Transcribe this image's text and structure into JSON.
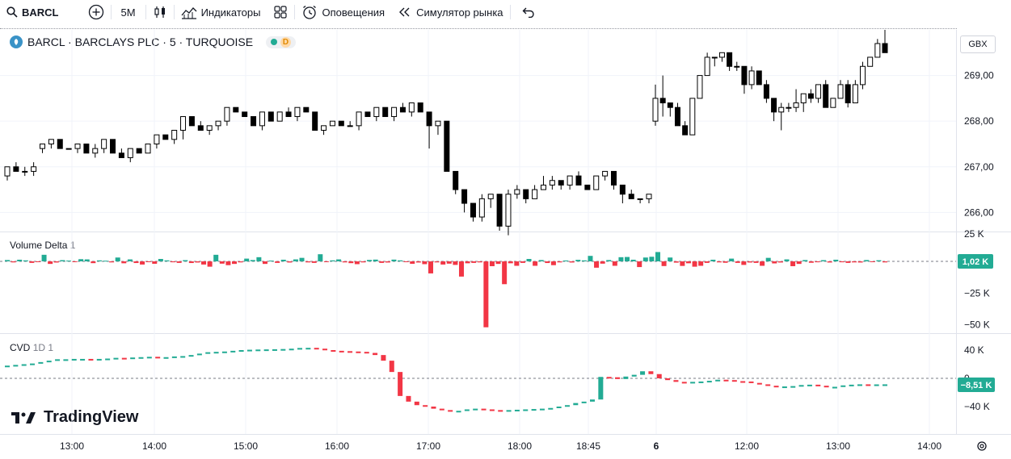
{
  "toolbar": {
    "symbol": "BARCL",
    "interval": "5M",
    "indicators": "Индикаторы",
    "alerts": "Оповещения",
    "replay": "Симулятор рынка"
  },
  "legend": {
    "title": "BARCL · BARCLAYS PLC · 5 · TURQUOISE",
    "badge": "D"
  },
  "currency": "GBX",
  "panes": {
    "volume_delta_name": "Volume Delta",
    "volume_delta_param": "1",
    "cvd_name": "CVD",
    "cvd_param": "1D 1"
  },
  "brand": {
    "name": "TradingView"
  },
  "colors": {
    "up": "#22ab94",
    "down": "#f23645",
    "candle": "#000000"
  },
  "chart_data": [
    {
      "type": "candlestick",
      "x_labels": [
        "13:00",
        "14:00",
        "15:00",
        "16:00",
        "17:00",
        "18:00",
        "18:45",
        "6",
        "12:00",
        "13:00",
        "14:00"
      ],
      "y_ticks": [
        "269,00",
        "268,00",
        "267,00",
        "266,00"
      ],
      "ylim": [
        265.6,
        270.0
      ],
      "candles": [
        [
          266.8,
          267.0,
          266.7,
          267.0
        ],
        [
          267.0,
          267.1,
          266.9,
          266.9
        ],
        [
          266.9,
          267.0,
          266.8,
          266.9
        ],
        [
          266.9,
          267.1,
          266.8,
          267.0
        ],
        [
          267.4,
          267.5,
          267.3,
          267.5
        ],
        [
          267.5,
          267.6,
          267.4,
          267.6
        ],
        [
          267.6,
          267.6,
          267.4,
          267.4
        ],
        [
          267.4,
          267.4,
          267.4,
          267.4
        ],
        [
          267.4,
          267.5,
          267.3,
          267.5
        ],
        [
          267.5,
          267.5,
          267.3,
          267.3
        ],
        [
          267.3,
          267.5,
          267.2,
          267.4
        ],
        [
          267.4,
          267.6,
          267.3,
          267.6
        ],
        [
          267.6,
          267.6,
          267.3,
          267.3
        ],
        [
          267.3,
          267.4,
          267.2,
          267.2
        ],
        [
          267.2,
          267.4,
          267.1,
          267.4
        ],
        [
          267.4,
          267.4,
          267.3,
          267.3
        ],
        [
          267.3,
          267.5,
          267.3,
          267.5
        ],
        [
          267.5,
          267.7,
          267.4,
          267.7
        ],
        [
          267.7,
          267.7,
          267.6,
          267.6
        ],
        [
          267.6,
          267.8,
          267.5,
          267.8
        ],
        [
          267.8,
          268.1,
          267.6,
          268.1
        ],
        [
          268.1,
          268.1,
          267.9,
          267.9
        ],
        [
          267.9,
          268.0,
          267.8,
          267.8
        ],
        [
          267.8,
          267.9,
          267.7,
          267.9
        ],
        [
          267.9,
          268.0,
          267.8,
          268.0
        ],
        [
          268.0,
          268.3,
          267.9,
          268.3
        ],
        [
          268.3,
          268.3,
          268.2,
          268.2
        ],
        [
          268.2,
          268.2,
          268.1,
          268.1
        ],
        [
          268.1,
          268.1,
          267.9,
          267.9
        ],
        [
          267.9,
          268.2,
          267.8,
          268.2
        ],
        [
          268.2,
          268.2,
          268.0,
          268.0
        ],
        [
          268.0,
          268.2,
          268.0,
          268.2
        ],
        [
          268.2,
          268.3,
          268.1,
          268.1
        ],
        [
          268.1,
          268.3,
          268.0,
          268.3
        ],
        [
          268.3,
          268.3,
          268.2,
          268.2
        ],
        [
          268.2,
          268.2,
          267.8,
          267.8
        ],
        [
          267.8,
          267.9,
          267.7,
          267.9
        ],
        [
          267.9,
          268.0,
          267.9,
          268.0
        ],
        [
          268.0,
          268.0,
          267.9,
          267.9
        ],
        [
          267.9,
          268.0,
          267.9,
          267.9
        ],
        [
          267.9,
          268.2,
          267.8,
          268.2
        ],
        [
          268.2,
          268.2,
          268.1,
          268.1
        ],
        [
          268.1,
          268.3,
          268.0,
          268.3
        ],
        [
          268.3,
          268.3,
          268.1,
          268.1
        ],
        [
          268.1,
          268.3,
          268.0,
          268.3
        ],
        [
          268.3,
          268.4,
          268.2,
          268.2
        ],
        [
          268.2,
          268.4,
          268.1,
          268.4
        ],
        [
          268.4,
          268.4,
          268.2,
          268.2
        ],
        [
          268.2,
          268.2,
          267.4,
          267.9
        ],
        [
          267.9,
          268.0,
          267.7,
          268.0
        ],
        [
          268.0,
          268.0,
          266.9,
          266.9
        ],
        [
          266.9,
          266.9,
          266.4,
          266.5
        ],
        [
          266.5,
          266.5,
          266.0,
          266.2
        ],
        [
          266.2,
          266.2,
          265.8,
          265.9
        ],
        [
          265.9,
          266.4,
          265.8,
          266.3
        ],
        [
          266.3,
          266.4,
          266.1,
          266.4
        ],
        [
          266.4,
          266.4,
          265.6,
          265.7
        ],
        [
          265.7,
          266.5,
          265.5,
          266.4
        ],
        [
          266.4,
          266.6,
          266.3,
          266.5
        ],
        [
          266.5,
          266.5,
          266.2,
          266.3
        ],
        [
          266.3,
          266.6,
          266.3,
          266.5
        ],
        [
          266.5,
          266.8,
          266.5,
          266.6
        ],
        [
          266.6,
          266.8,
          266.5,
          266.7
        ],
        [
          266.7,
          266.7,
          266.5,
          266.6
        ],
        [
          266.6,
          266.8,
          266.5,
          266.8
        ],
        [
          266.8,
          266.9,
          266.6,
          266.6
        ],
        [
          266.6,
          266.6,
          266.5,
          266.5
        ],
        [
          266.5,
          266.8,
          266.6,
          266.8
        ],
        [
          266.8,
          266.9,
          266.7,
          266.9
        ],
        [
          266.9,
          266.9,
          266.5,
          266.6
        ],
        [
          266.6,
          266.6,
          266.2,
          266.4
        ],
        [
          266.4,
          266.5,
          266.3,
          266.3
        ],
        [
          266.3,
          266.3,
          266.2,
          266.3
        ],
        [
          266.3,
          266.4,
          266.2,
          266.4
        ],
        [
          268.0,
          268.8,
          267.9,
          268.5
        ],
        [
          268.5,
          269.0,
          268.1,
          268.4
        ],
        [
          268.4,
          268.4,
          268.1,
          268.3
        ],
        [
          268.3,
          268.4,
          268.0,
          267.9
        ],
        [
          267.9,
          268.0,
          267.7,
          267.7
        ],
        [
          267.7,
          268.5,
          267.7,
          268.5
        ],
        [
          268.5,
          269.0,
          268.5,
          269.0
        ],
        [
          269.0,
          269.5,
          269.0,
          269.4
        ],
        [
          269.4,
          269.4,
          269.2,
          269.4
        ],
        [
          269.4,
          269.5,
          269.3,
          269.5
        ],
        [
          269.5,
          269.5,
          269.1,
          269.2
        ],
        [
          269.2,
          269.3,
          269.1,
          269.2
        ],
        [
          269.2,
          269.2,
          268.6,
          268.8
        ],
        [
          268.8,
          269.2,
          268.7,
          269.1
        ],
        [
          269.1,
          269.1,
          268.8,
          268.8
        ],
        [
          268.8,
          268.9,
          268.4,
          268.5
        ],
        [
          268.5,
          268.5,
          268.0,
          268.2
        ],
        [
          268.2,
          268.4,
          267.8,
          268.3
        ],
        [
          268.3,
          268.4,
          268.2,
          268.3
        ],
        [
          268.3,
          268.7,
          268.2,
          268.4
        ],
        [
          268.4,
          268.6,
          268.2,
          268.6
        ],
        [
          268.6,
          268.7,
          268.4,
          268.5
        ],
        [
          268.5,
          268.8,
          268.4,
          268.8
        ],
        [
          268.8,
          268.9,
          268.3,
          268.3
        ],
        [
          268.3,
          268.5,
          268.3,
          268.5
        ],
        [
          268.5,
          268.9,
          268.5,
          268.8
        ],
        [
          268.8,
          268.9,
          268.3,
          268.4
        ],
        [
          268.4,
          268.9,
          268.4,
          268.8
        ],
        [
          268.8,
          269.3,
          268.7,
          269.2
        ],
        [
          269.2,
          269.4,
          269.3,
          269.4
        ],
        [
          269.4,
          269.8,
          269.4,
          269.7
        ],
        [
          269.7,
          270.0,
          269.5,
          269.5
        ]
      ]
    },
    {
      "type": "bar",
      "name": "Volume Delta",
      "y_ticks": [
        "25 K",
        "−25 K",
        "−50 K"
      ],
      "ylim": [
        -56000,
        25000
      ],
      "last_value_label": "1,02 K",
      "values": [
        1200,
        -800,
        1500,
        900,
        -1200,
        -600,
        6000,
        -2000,
        -900,
        1100,
        700,
        -500,
        2000,
        1800,
        -1400,
        900,
        600,
        -800,
        3500,
        -1500,
        1800,
        -1300,
        -2500,
        -600,
        -1900,
        2200,
        900,
        -700,
        -1200,
        1100,
        -1300,
        -900,
        -2500,
        -4200,
        6000,
        -1800,
        -3000,
        -2000,
        -800,
        2500,
        1200,
        3800,
        -2000,
        700,
        -1200,
        1500,
        -900,
        1800,
        3200,
        -800,
        -1200,
        6500,
        -600,
        900,
        1800,
        -800,
        -1400,
        -2200,
        -800,
        1300,
        1600,
        -1200,
        -900,
        1600,
        900,
        -600,
        -1900,
        -900,
        -2200,
        -9500,
        -800,
        -2500,
        -1800,
        -2800,
        -12000,
        -1500,
        -1200,
        -800,
        -52000,
        -3800,
        -2000,
        -18000,
        -1500,
        -3500,
        -1200,
        2200,
        -3500,
        1200,
        -1300,
        -3000,
        -800,
        800,
        -900,
        1400,
        900,
        5000,
        -5000,
        -1800,
        1200,
        -3500,
        3800,
        4000,
        1500,
        -4500,
        3500,
        4200,
        8500,
        -3700,
        3500,
        -1000,
        -3600,
        -1500,
        -4200,
        -3500,
        -1200,
        1500,
        -800,
        -1100,
        2500,
        -1200,
        -2800,
        -900,
        -1200,
        -3500,
        3200,
        -1600,
        -900,
        1800,
        -3800,
        -2000,
        1200,
        -1100,
        -700,
        1100,
        -900,
        1500,
        -700,
        -1200,
        -800,
        -900,
        1200,
        -500,
        1000,
        -800
      ],
      "bar_count_note": ""
    },
    {
      "type": "bar",
      "name": "CVD",
      "y_ticks": [
        "40 K",
        "0",
        "−40 K"
      ],
      "ylim": [
        -65000,
        45000
      ],
      "last_value_label": "−8,51 K",
      "values": [
        18000,
        19000,
        20000,
        21000,
        23000,
        25000,
        27000,
        27000,
        27500,
        27500,
        27000,
        27500,
        28000,
        29000,
        28500,
        29500,
        30000,
        30500,
        29000,
        30000,
        31000,
        31500,
        33000,
        35000,
        37000,
        37500,
        38000,
        39000,
        40000,
        40500,
        40800,
        41000,
        41200,
        41500,
        42000,
        43000,
        43200,
        42000,
        40000,
        39000,
        38500,
        38000,
        37500,
        36000,
        33000,
        25000,
        9000,
        -25000,
        -33000,
        -38000,
        -40000,
        -43000,
        -45000,
        -47000,
        -46000,
        -44000,
        -43000,
        -44000,
        -45000,
        -45500,
        -45000,
        -44500,
        -44000,
        -43500,
        -43000,
        -42000,
        -40000,
        -38000,
        -35000,
        -33000,
        -30000,
        2000,
        1500,
        -1000,
        2500,
        5000,
        10000,
        6000,
        0,
        -2500,
        -5000,
        -5500,
        -5000,
        -4500,
        -3500,
        -2000,
        -2500,
        -4000,
        -4500,
        -6500,
        -8500,
        -10500,
        -12000,
        -11500,
        -11000,
        -9500,
        -9000,
        -10500,
        -12500,
        -12000,
        -10000,
        -9000,
        -8500,
        -8700,
        -8600,
        -8510
      ]
    }
  ]
}
